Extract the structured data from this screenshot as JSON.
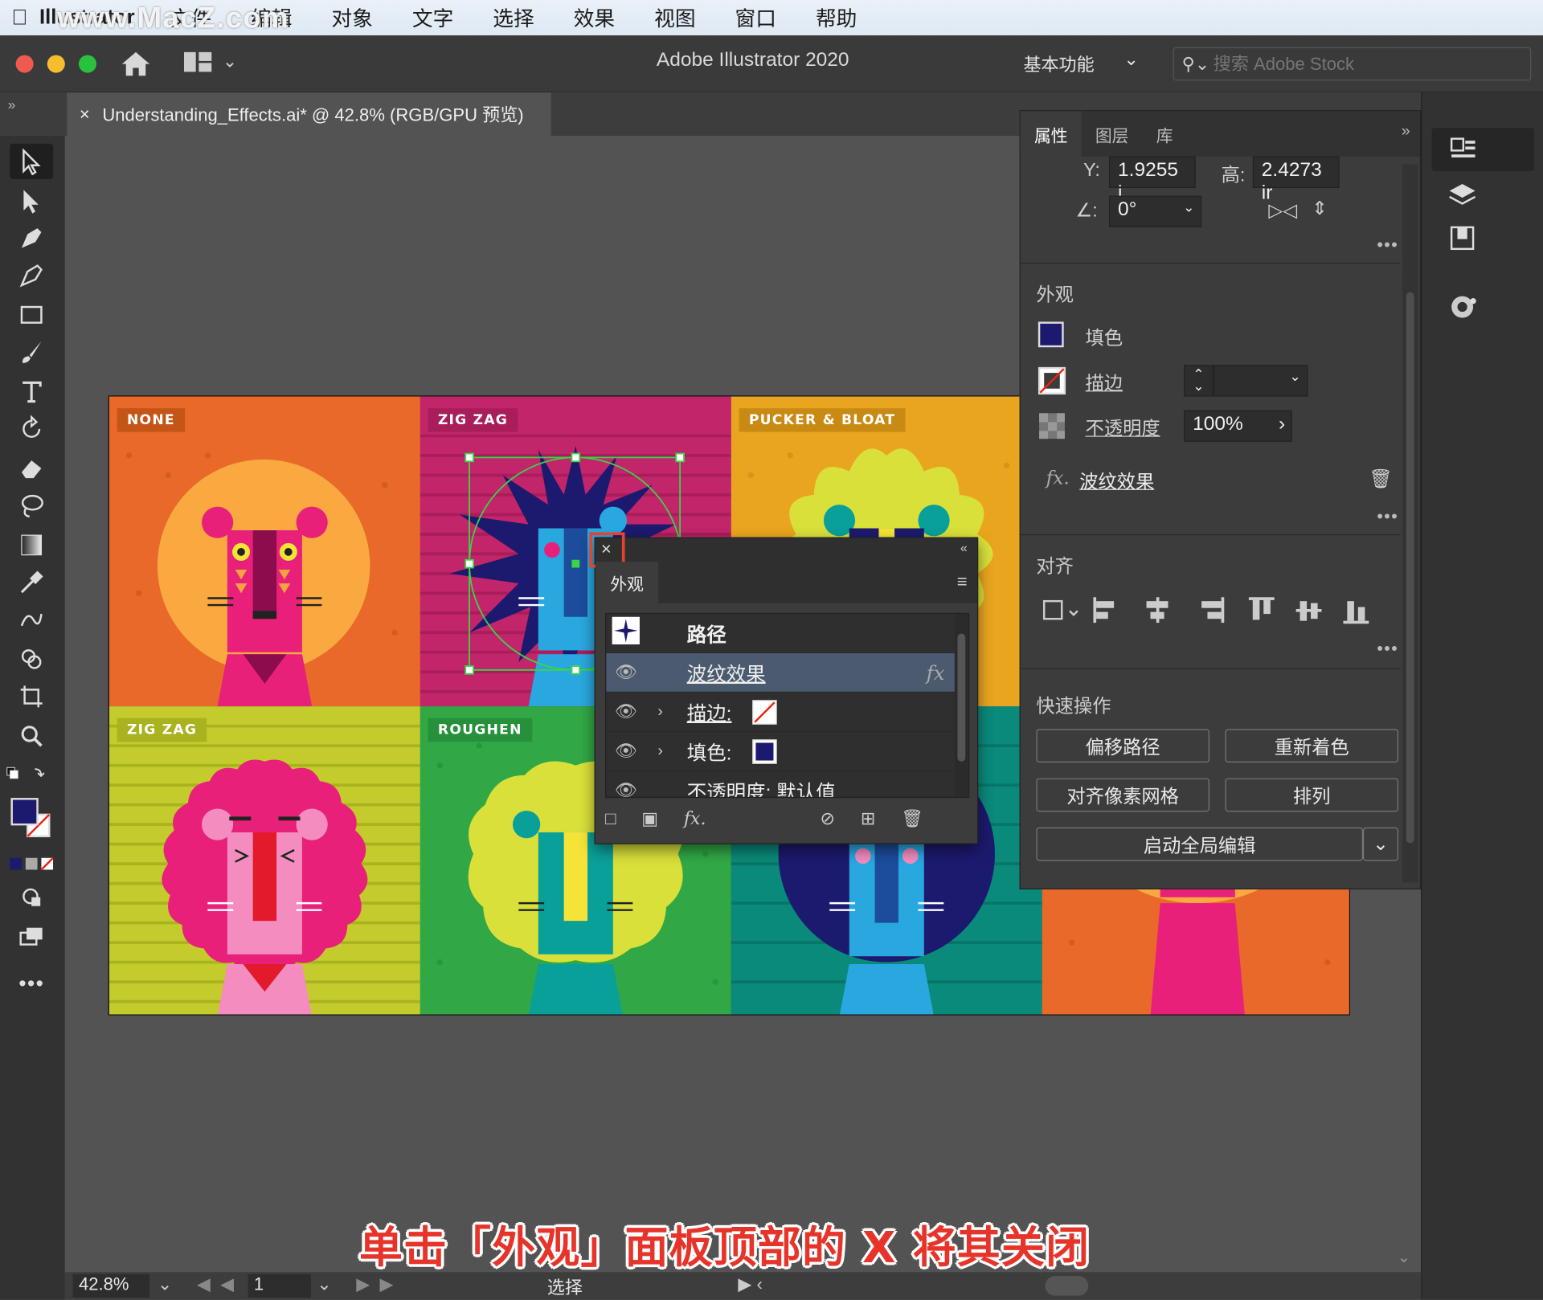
{
  "menubar": {
    "app_name": "Illustrator",
    "items": [
      "文件",
      "编辑",
      "对象",
      "文字",
      "选择",
      "效果",
      "视图",
      "窗口",
      "帮助"
    ],
    "watermark": "www.MacZ.com"
  },
  "window": {
    "title": "Adobe Illustrator 2020",
    "workspace": "基本功能",
    "search_placeholder": "搜索 Adobe Stock"
  },
  "document": {
    "tab_label": "Understanding_Effects.ai* @ 42.8% (RGB/GPU 预览)"
  },
  "artboard": {
    "cells": [
      {
        "label": "NONE",
        "bg": "#e8692a"
      },
      {
        "label": "ZIG ZAG",
        "bg": "#c2256a"
      },
      {
        "label": "PUCKER & BLOAT",
        "bg": "#e9a51f"
      },
      {
        "label": "ZIG ZAG",
        "bg": "#c3cc2c"
      },
      {
        "label": "ROUGHEN",
        "bg": "#31a845"
      },
      {
        "label": "",
        "bg": "#0a8a7a"
      },
      {
        "label": "",
        "bg": "#e8692a"
      }
    ]
  },
  "appearance_panel": {
    "tab": "外观",
    "rows": [
      {
        "name": "路径",
        "type": "header"
      },
      {
        "name": "波纹效果",
        "type": "effect",
        "fx": "fx"
      },
      {
        "name": "描边:",
        "type": "stroke"
      },
      {
        "name": "填色:",
        "type": "fill"
      },
      {
        "name": "不透明度: 默认值",
        "type": "opacity"
      }
    ]
  },
  "properties_panel": {
    "tabs": [
      "属性",
      "图层",
      "库"
    ],
    "transform": {
      "y_label": "Y:",
      "y_value": "1.9255 i",
      "h_label": "高:",
      "h_value": "2.4273 ir",
      "angle_value": "0°"
    },
    "appearance": {
      "title": "外观",
      "fill_label": "填色",
      "stroke_label": "描边",
      "opacity_label": "不透明度",
      "opacity_value": "100%",
      "effect_label": "波纹效果",
      "fill_color": "#1c1a6e"
    },
    "align": {
      "title": "对齐"
    },
    "quick_actions": {
      "title": "快速操作",
      "buttons": [
        "偏移路径",
        "重新着色",
        "对齐像素网格",
        "排列"
      ],
      "global_edit": "启动全局编辑"
    }
  },
  "statusbar": {
    "zoom": "42.8%",
    "page": "1",
    "tool": "选择"
  },
  "caption": "单击「外观」面板顶部的 X 将其关闭",
  "colors": {
    "accent_highlight": "#e8412c",
    "selection_row": "#4b5a6e"
  }
}
